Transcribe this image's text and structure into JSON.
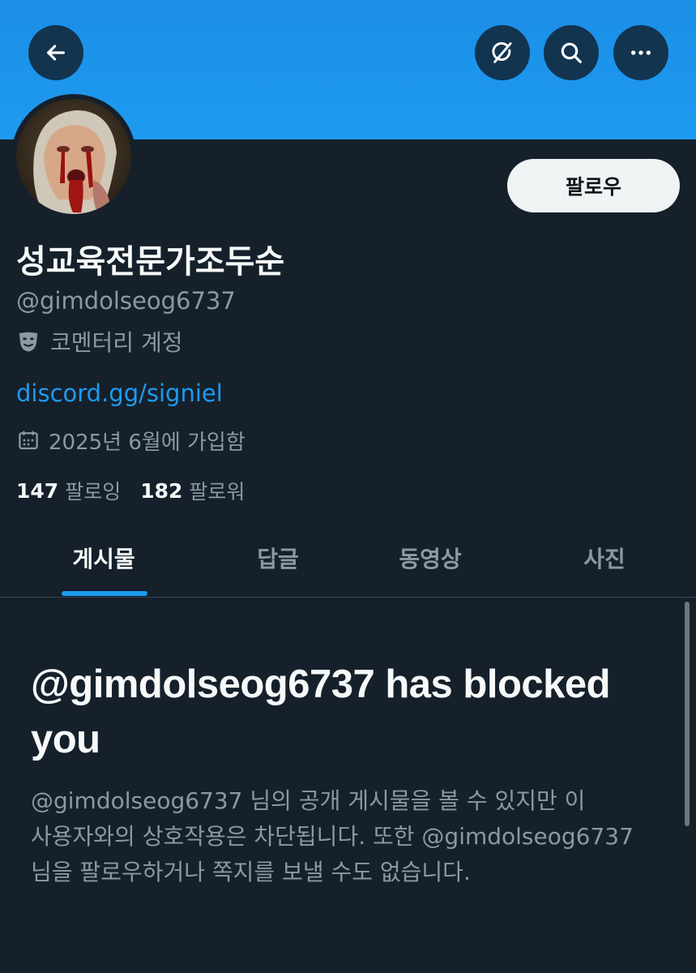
{
  "header": {
    "back_icon": "arrow-left-icon",
    "grok_icon": "grok-icon",
    "search_icon": "search-icon",
    "more_icon": "more-horizontal-icon",
    "banner_color": "#1d9bf0"
  },
  "profile": {
    "follow_label": "팔로우",
    "display_name": "성교육전문가조두순",
    "handle": "@gimdolseog6737",
    "account_label": "코멘터리 계정",
    "link": "discord.gg/signiel",
    "joined": "2025년 6월에 가입함",
    "following_count": "147",
    "following_label": "팔로잉",
    "followers_count": "182",
    "followers_label": "팔로워"
  },
  "tabs": [
    {
      "label": "게시물",
      "active": true
    },
    {
      "label": "답글",
      "active": false
    },
    {
      "label": "동영상",
      "active": false
    },
    {
      "label": "사진",
      "active": false
    }
  ],
  "blocked": {
    "title": "@gimdolseog6737 has blocked you",
    "description": "@gimdolseog6737 님의 공개 게시물을 볼 수 있지만 이 사용자와의 상호작용은 차단됩니다. 또한 @gimdolseog6737 님을 팔로우하거나 쪽지를 보낼 수도 없습니다."
  },
  "colors": {
    "background": "#15202b",
    "accent": "#1d9bf0",
    "secondary_text": "#8b98a5",
    "primary_text": "#f7f9f9"
  }
}
